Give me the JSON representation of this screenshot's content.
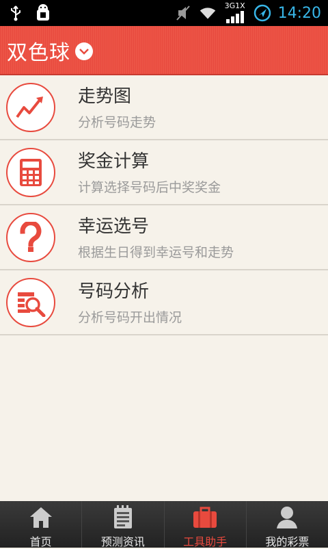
{
  "statusbar": {
    "time": "14:20",
    "network": "3G1X",
    "icons": [
      "usb-icon",
      "android-debug-icon",
      "mute-icon",
      "wifi-icon",
      "signal-icon",
      "app-notification-icon"
    ]
  },
  "header": {
    "title": "双色球",
    "accent": "#e84a3e"
  },
  "list": {
    "items": [
      {
        "title": "走势图",
        "subtitle": "分析号码走势",
        "icon": "trend-chart-icon"
      },
      {
        "title": "奖金计算",
        "subtitle": "计算选择号码后中奖奖金",
        "icon": "calculator-icon"
      },
      {
        "title": "幸运选号",
        "subtitle": "根据生日得到幸运号和走势",
        "icon": "question-mark-icon"
      },
      {
        "title": "号码分析",
        "subtitle": "分析号码开出情况",
        "icon": "analysis-search-icon"
      }
    ]
  },
  "tabbar": {
    "tabs": [
      {
        "label": "首页",
        "icon": "home-icon",
        "active": false
      },
      {
        "label": "预测资讯",
        "icon": "news-icon",
        "active": false
      },
      {
        "label": "工具助手",
        "icon": "toolbox-icon",
        "active": true
      },
      {
        "label": "我的彩票",
        "icon": "user-icon",
        "active": false
      }
    ]
  }
}
